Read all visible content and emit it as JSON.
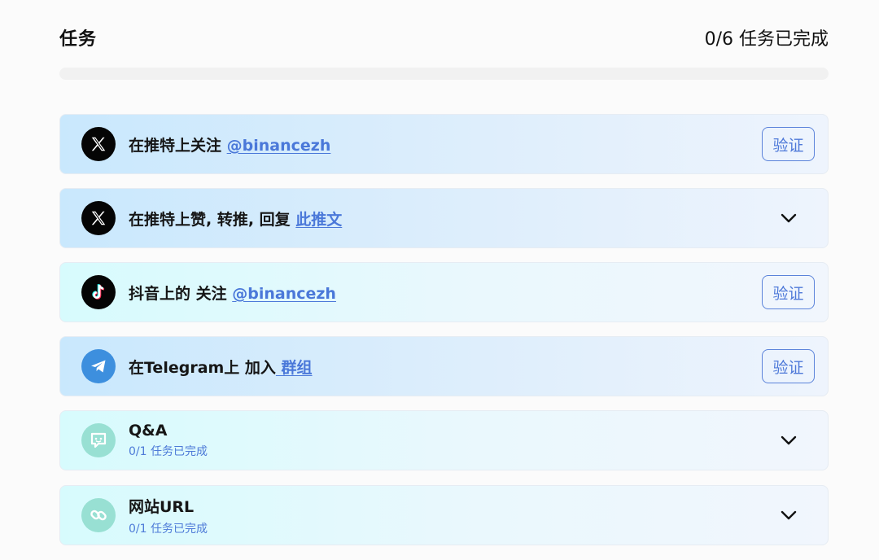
{
  "header": {
    "title": "任务",
    "progress_text": "0/6 任务已完成"
  },
  "progress": {
    "completed_fraction": 0
  },
  "tasks": [
    {
      "title": "在推特上关注 ",
      "link": "@binancezh",
      "icon": "x-logo-icon",
      "action": "验证"
    },
    {
      "title": "在推特上赞, 转推, 回复 ",
      "link": "此推文",
      "icon": "x-logo-icon",
      "action": "chevron-down-icon"
    },
    {
      "title": "抖音上的 关注 ",
      "link": "@binancezh",
      "icon": "tiktok-logo-icon",
      "action": "验证"
    },
    {
      "title": "在Telegram上 加入",
      "link": " 群组",
      "icon": "telegram-logo-icon",
      "action": "验证"
    },
    {
      "title": "Q&A",
      "subtitle": "0/1 任务已完成",
      "icon": "chat-bubble-icon",
      "action": "chevron-down-icon"
    },
    {
      "title": "网站URL",
      "subtitle": "0/1 任务已完成",
      "icon": "link-icon",
      "action": "chevron-down-icon"
    }
  ],
  "colors": {
    "accent": "#4a78d9",
    "telegram": "#3d8fde",
    "mint_icon": "#98e0d3"
  }
}
